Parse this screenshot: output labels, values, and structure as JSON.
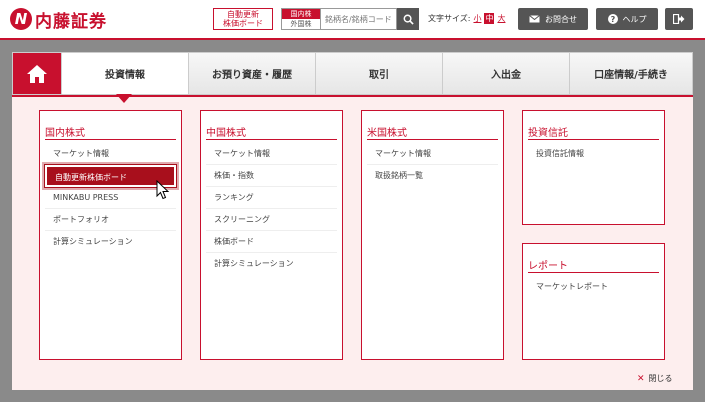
{
  "header": {
    "logo_text": "内藤証券",
    "logo_mark": "N",
    "auto_board_line1": "自動更新",
    "auto_board_line2": "株価ボード",
    "market_domestic": "国内株",
    "market_foreign": "外国株",
    "search_placeholder": "銘柄名/銘柄コード",
    "fontsize_label": "文字サイズ:",
    "fontsize_small": "小",
    "fontsize_medium": "中",
    "fontsize_large": "大",
    "contact_label": "お問合せ",
    "help_label": "ヘルプ"
  },
  "nav": {
    "items": [
      {
        "label": "投資情報",
        "active": true
      },
      {
        "label": "お預り資産・履歴",
        "active": false
      },
      {
        "label": "取引",
        "active": false
      },
      {
        "label": "入出金",
        "active": false
      },
      {
        "label": "口座情報/手続き",
        "active": false
      }
    ]
  },
  "menu": {
    "domestic": {
      "title": "国内株式",
      "items": [
        "マーケット情報",
        "自動更新株価ボード",
        "MINKABU PRESS",
        "ポートフォリオ",
        "計算シミュレーション"
      ]
    },
    "china": {
      "title": "中国株式",
      "items": [
        "マーケット情報",
        "株価・指数",
        "ランキング",
        "スクリーニング",
        "株価ボード",
        "計算シミュレーション"
      ]
    },
    "us": {
      "title": "米国株式",
      "items": [
        "マーケット情報",
        "取扱銘柄一覧"
      ]
    },
    "fund": {
      "title": "投資信託",
      "items": [
        "投資信託情報"
      ]
    },
    "report": {
      "title": "レポート",
      "items": [
        "マーケットレポート"
      ]
    }
  },
  "close_label": "閉じる",
  "colors": {
    "brand": "#c8102e",
    "highlight": "#a80f1c",
    "panel_bg": "#fdeeee"
  }
}
